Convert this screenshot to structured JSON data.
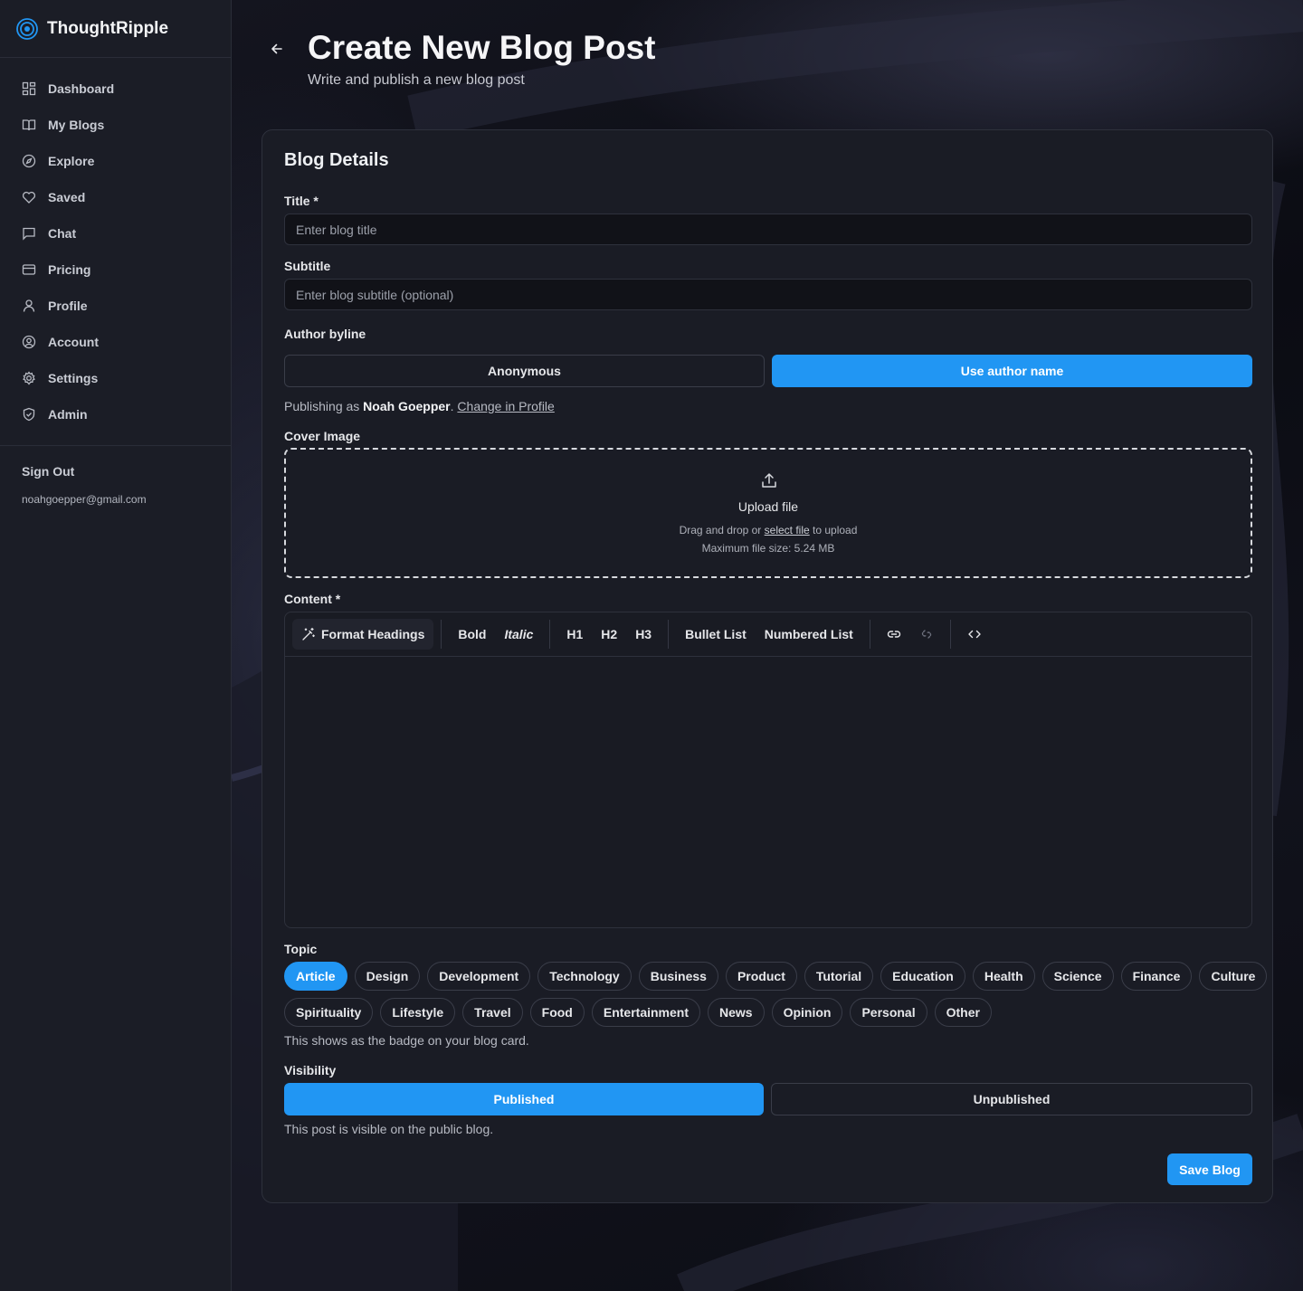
{
  "app": {
    "name": "ThoughtRipple"
  },
  "sidebar": {
    "items": [
      {
        "label": "Dashboard",
        "icon": "dashboard-icon"
      },
      {
        "label": "My Blogs",
        "icon": "book-icon"
      },
      {
        "label": "Explore",
        "icon": "compass-icon"
      },
      {
        "label": "Saved",
        "icon": "heart-icon"
      },
      {
        "label": "Chat",
        "icon": "chat-icon"
      },
      {
        "label": "Pricing",
        "icon": "credit-card-icon"
      },
      {
        "label": "Profile",
        "icon": "user-icon"
      },
      {
        "label": "Account",
        "icon": "user-circle-icon"
      },
      {
        "label": "Settings",
        "icon": "gear-icon"
      },
      {
        "label": "Admin",
        "icon": "shield-icon"
      }
    ],
    "sign_out": "Sign Out",
    "email": "noahgoepper@gmail.com"
  },
  "header": {
    "title": "Create New Blog Post",
    "subtitle": "Write and publish a new blog post"
  },
  "form": {
    "card_title": "Blog Details",
    "title_label": "Title *",
    "title_placeholder": "Enter blog title",
    "subtitle_label": "Subtitle",
    "subtitle_placeholder": "Enter blog subtitle (optional)",
    "byline_label": "Author byline",
    "byline_options": [
      "Anonymous",
      "Use author name"
    ],
    "byline_selected": "Use author name",
    "publishing_prefix": "Publishing as",
    "author_name": "Noah Goepper",
    "change_link": "Change in Profile",
    "cover_label": "Cover Image",
    "upload_title": "Upload file",
    "upload_drag": "Drag and drop or",
    "upload_select": "select file",
    "upload_suffix": "to upload",
    "upload_max": "Maximum file size: 5.24 MB",
    "content_label": "Content *",
    "toolbar": {
      "format_headings": "Format Headings",
      "bold": "Bold",
      "italic": "Italic",
      "h1": "H1",
      "h2": "H2",
      "h3": "H3",
      "bullet_list": "Bullet List",
      "numbered_list": "Numbered List"
    },
    "topic_label": "Topic",
    "topics": [
      "Article",
      "Design",
      "Development",
      "Technology",
      "Business",
      "Product",
      "Tutorial",
      "Education",
      "Health",
      "Science",
      "Finance",
      "Culture",
      "Spirituality",
      "Lifestyle",
      "Travel",
      "Food",
      "Entertainment",
      "News",
      "Opinion",
      "Personal",
      "Other"
    ],
    "topic_selected": "Article",
    "topic_help": "This shows as the badge on your blog card.",
    "visibility_label": "Visibility",
    "visibility_options": [
      "Published",
      "Unpublished"
    ],
    "visibility_selected": "Published",
    "visibility_help": "This post is visible on the public blog.",
    "save_label": "Save Blog"
  },
  "colors": {
    "accent": "#2196f3",
    "sidebar_bg": "#1b1d26",
    "card_bg": "#1a1c25"
  }
}
